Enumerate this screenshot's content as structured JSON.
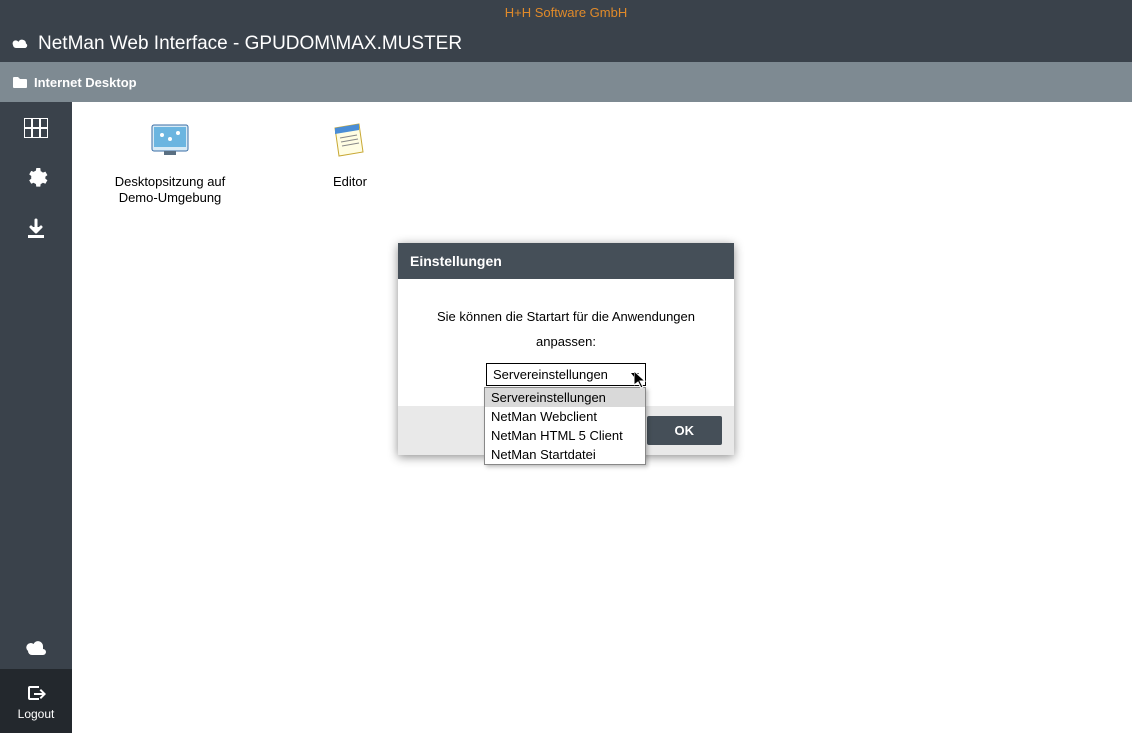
{
  "topbar": {
    "company": "H+H Software GmbH"
  },
  "title": "NetMan Web Interface - GPUDOM\\MAX.MUSTER",
  "breadcrumb": "Internet Desktop",
  "sidebar": {
    "logout": "Logout"
  },
  "apps": [
    {
      "label": "Desktopsitzung auf Demo-Umgebung"
    },
    {
      "label": "Editor"
    }
  ],
  "modal": {
    "title": "Einstellungen",
    "line1": "Sie können die Startart für die Anwendungen",
    "line2": "anpassen:",
    "selected": "Servereinstellungen",
    "options": [
      "Servereinstellungen",
      "NetMan Webclient",
      "NetMan HTML 5 Client",
      "NetMan Startdatei"
    ],
    "ok": "OK"
  }
}
